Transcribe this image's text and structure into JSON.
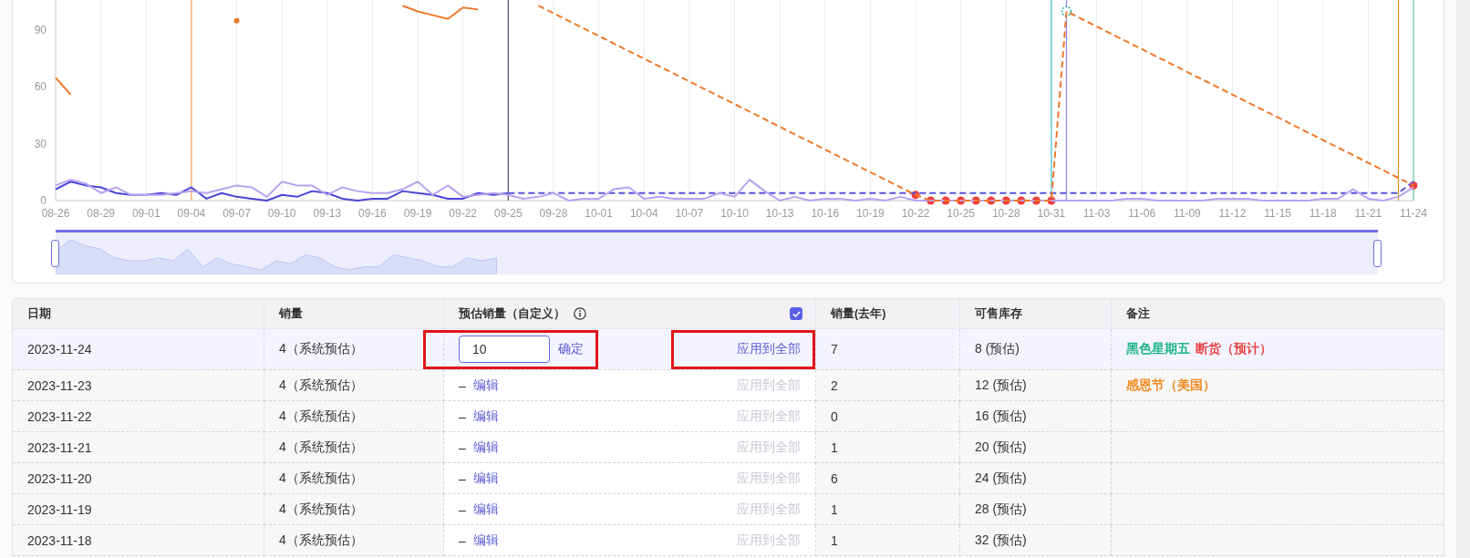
{
  "chart": {
    "chart_data": {
      "type": "line",
      "categories": [
        "08-26",
        null,
        null,
        "08-29",
        null,
        null,
        "09-01",
        null,
        null,
        "09-04",
        null,
        null,
        "09-07",
        null,
        null,
        "09-10",
        null,
        null,
        "09-13",
        null,
        null,
        "09-16",
        null,
        null,
        "09-19",
        null,
        null,
        "09-22",
        null,
        null,
        "09-25",
        null,
        null,
        "09-28",
        null,
        null,
        "10-01",
        null,
        null,
        "10-04",
        null,
        null,
        "10-07",
        null,
        null,
        "10-10",
        null,
        null,
        "10-13",
        null,
        null,
        "10-16",
        null,
        null,
        "10-19",
        null,
        null,
        "10-22",
        null,
        null,
        "10-25",
        null,
        null,
        "10-28",
        null,
        null,
        "10-31",
        null,
        null,
        "11-03",
        null,
        null,
        "11-06",
        null,
        null,
        "11-09",
        null,
        null,
        "11-12",
        null,
        null,
        "11-15",
        null,
        null,
        "11-18",
        null,
        null,
        "11-21",
        null,
        null,
        "11-24"
      ],
      "ylim": [
        0,
        106
      ],
      "yticks": [
        0,
        30,
        60,
        90
      ],
      "grid": true,
      "series": [
        {
          "color": "#4a45d6",
          "values": [
            6,
            10,
            8,
            7,
            4,
            3,
            3,
            4,
            3,
            7,
            1,
            4,
            2,
            1,
            0,
            3,
            2,
            5,
            4,
            1,
            0,
            1,
            1,
            5,
            4,
            3,
            1,
            1,
            4,
            3,
            4,
            null,
            null,
            null,
            null,
            null,
            null,
            null,
            null,
            null,
            null,
            null,
            null,
            null,
            null,
            null,
            null,
            null,
            null,
            null,
            null,
            null,
            null,
            null,
            null,
            null,
            null,
            null,
            null,
            null,
            null,
            null,
            null,
            null,
            null,
            null,
            null,
            null,
            null,
            null,
            null,
            null,
            null,
            null,
            null,
            null,
            null,
            null,
            null,
            null,
            null,
            null,
            null,
            null,
            null,
            null,
            null,
            null,
            null,
            null,
            null
          ]
        },
        {
          "color": "#5753dc",
          "line_style": "dashed",
          "values": [
            null,
            null,
            null,
            null,
            null,
            null,
            null,
            null,
            null,
            null,
            null,
            null,
            null,
            null,
            null,
            null,
            null,
            null,
            null,
            null,
            null,
            null,
            null,
            null,
            null,
            null,
            null,
            null,
            null,
            null,
            4,
            4,
            4,
            4,
            4,
            4,
            4,
            4,
            4,
            4,
            4,
            4,
            4,
            4,
            4,
            4,
            4,
            4,
            4,
            4,
            4,
            4,
            4,
            4,
            4,
            4,
            4,
            4,
            4,
            4,
            4,
            4,
            4,
            4,
            4,
            4,
            4,
            4,
            4,
            4,
            4,
            4,
            4,
            4,
            4,
            4,
            4,
            4,
            4,
            4,
            4,
            4,
            4,
            4,
            4,
            4,
            4,
            4,
            4,
            4,
            10
          ]
        },
        {
          "color": "#b8a2f0",
          "values": [
            8,
            11,
            9,
            4,
            7,
            3,
            3,
            3,
            4,
            5,
            4,
            6,
            8,
            7,
            2,
            10,
            8,
            8,
            3,
            7,
            5,
            4,
            4,
            6,
            10,
            3,
            8,
            2,
            3,
            4,
            3,
            1,
            2,
            4,
            0,
            1,
            1,
            6,
            7,
            1,
            2,
            1,
            1,
            1,
            4,
            2,
            11,
            5,
            0,
            2,
            0,
            1,
            1,
            0,
            1,
            0,
            2,
            0,
            0,
            0,
            0,
            0,
            0,
            0,
            0,
            0,
            0,
            0,
            0,
            0,
            0,
            1,
            1,
            0,
            0,
            0,
            0,
            1,
            1,
            1,
            0,
            0,
            0,
            0,
            1,
            1,
            6,
            1,
            0,
            2,
            7
          ]
        },
        {
          "color": "#f0782a",
          "values": [
            65,
            56,
            null,
            null,
            null,
            null,
            null,
            null,
            null,
            null,
            null,
            null,
            95,
            null,
            null,
            null,
            null,
            null,
            null,
            null,
            null,
            null,
            null,
            103,
            100,
            98,
            96,
            102,
            101,
            null,
            null,
            null,
            null,
            null,
            null,
            null,
            null,
            null,
            null,
            null,
            null,
            null,
            null,
            null,
            null,
            null,
            null,
            null,
            null,
            null,
            null,
            null,
            null,
            null,
            null,
            null,
            null,
            null,
            null,
            null,
            null,
            null,
            null,
            null,
            null,
            null,
            null,
            null,
            null,
            null,
            null,
            null,
            null,
            null,
            null,
            null,
            null,
            null,
            null,
            null,
            null,
            null,
            null,
            null,
            null,
            null,
            null,
            null,
            null,
            null,
            null
          ]
        },
        {
          "color": "#f0782a",
          "line_style": "dashed",
          "values": [
            null,
            null,
            null,
            null,
            null,
            null,
            null,
            null,
            null,
            null,
            null,
            null,
            null,
            null,
            null,
            null,
            null,
            null,
            null,
            null,
            null,
            null,
            null,
            null,
            null,
            null,
            null,
            null,
            null,
            null,
            null,
            null,
            103,
            99,
            95,
            91,
            87,
            83,
            79,
            75,
            71,
            67,
            63,
            59,
            55,
            51,
            47,
            43,
            39,
            35,
            31,
            27,
            23,
            19,
            15,
            11,
            7,
            3,
            0,
            0,
            0,
            0,
            0,
            0,
            0,
            0,
            0,
            100,
            96,
            92,
            88,
            84,
            80,
            76,
            72,
            68,
            64,
            60,
            56,
            52,
            48,
            44,
            40,
            36,
            32,
            28,
            24,
            20,
            16,
            12,
            8
          ]
        },
        {
          "color": "#ef3e3e",
          "type": "scatter",
          "values": [
            null,
            null,
            null,
            null,
            null,
            null,
            null,
            null,
            null,
            null,
            null,
            null,
            null,
            null,
            null,
            null,
            null,
            null,
            null,
            null,
            null,
            null,
            null,
            null,
            null,
            null,
            null,
            null,
            null,
            null,
            null,
            null,
            null,
            null,
            null,
            null,
            null,
            null,
            null,
            null,
            null,
            null,
            null,
            null,
            null,
            null,
            null,
            null,
            null,
            null,
            null,
            null,
            null,
            null,
            null,
            null,
            null,
            3,
            0,
            0,
            0,
            0,
            0,
            0,
            0,
            0,
            0,
            null,
            null,
            null,
            null,
            null,
            null,
            null,
            null,
            null,
            null,
            null,
            null,
            null,
            null,
            null,
            null,
            null,
            null,
            null,
            null,
            null,
            null,
            null,
            8
          ]
        }
      ],
      "ref_lines": [
        {
          "axis": "x",
          "value": "09-04",
          "color": "#f3a35c"
        },
        {
          "axis": "x",
          "value": "09-25",
          "color": "#4b4f60"
        },
        {
          "axis": "x",
          "value": "10-31",
          "color": "#40c4d4"
        },
        {
          "axis": "x",
          "value": "11-24",
          "color": "#58cfa0"
        }
      ]
    },
    "slider": {
      "level": 1
    }
  },
  "table": {
    "columns": [
      {
        "label": "日期"
      },
      {
        "label": "销量"
      },
      {
        "label": "预估销量（自定义）",
        "info": true,
        "checked": true
      },
      {
        "label": "销量(去年)"
      },
      {
        "label": "可售库存"
      },
      {
        "label": "备注"
      }
    ],
    "rows": [
      {
        "selected": true,
        "date": "2023-11-24",
        "sales": "4（系统预估）",
        "estimate": {
          "kind": "input",
          "value": "10",
          "action": "确定",
          "highlighted": true
        },
        "apply": {
          "label": "应用到全部",
          "disabled": false,
          "highlighted": true
        },
        "last_year": "7",
        "stock": "8 (预估)",
        "notes": [
          {
            "text": "黑色星期五",
            "color": "#1cb585"
          },
          {
            "text": "断货（预计）",
            "color": "#e84a4a"
          }
        ]
      },
      {
        "selected": false,
        "date": "2023-11-23",
        "sales": "4（系统预估）",
        "estimate": {
          "kind": "text",
          "value": "–",
          "action": "编辑",
          "highlighted": false
        },
        "apply": {
          "label": "应用到全部",
          "disabled": true,
          "highlighted": false
        },
        "last_year": "2",
        "stock": "12 (预估)",
        "notes": [
          {
            "text": "感恩节（美国）",
            "color": "#f08a1f"
          }
        ]
      },
      {
        "selected": false,
        "date": "2023-11-22",
        "sales": "4（系统预估）",
        "estimate": {
          "kind": "text",
          "value": "–",
          "action": "编辑",
          "highlighted": false
        },
        "apply": {
          "label": "应用到全部",
          "disabled": true,
          "highlighted": false
        },
        "last_year": "0",
        "stock": "16 (预估)"
      },
      {
        "selected": false,
        "date": "2023-11-21",
        "sales": "4（系统预估）",
        "estimate": {
          "kind": "text",
          "value": "–",
          "action": "编辑",
          "highlighted": false
        },
        "apply": {
          "label": "应用到全部",
          "disabled": true,
          "highlighted": false
        },
        "last_year": "1",
        "stock": "20 (预估)"
      },
      {
        "selected": false,
        "date": "2023-11-20",
        "sales": "4（系统预估）",
        "estimate": {
          "kind": "text",
          "value": "–",
          "action": "编辑",
          "highlighted": false
        },
        "apply": {
          "label": "应用到全部",
          "disabled": true,
          "highlighted": false
        },
        "last_year": "6",
        "stock": "24 (预估)"
      },
      {
        "selected": false,
        "date": "2023-11-19",
        "sales": "4（系统预估）",
        "estimate": {
          "kind": "text",
          "value": "–",
          "action": "编辑",
          "highlighted": false
        },
        "apply": {
          "label": "应用到全部",
          "disabled": true,
          "highlighted": false
        },
        "last_year": "1",
        "stock": "28 (预估)"
      },
      {
        "selected": false,
        "date": "2023-11-18",
        "sales": "4（系统预估）",
        "estimate": {
          "kind": "text",
          "value": "–",
          "action": "编辑",
          "highlighted": false
        },
        "apply": {
          "label": "应用到全部",
          "disabled": true,
          "highlighted": false
        },
        "last_year": "1",
        "stock": "32 (预估)"
      }
    ]
  }
}
